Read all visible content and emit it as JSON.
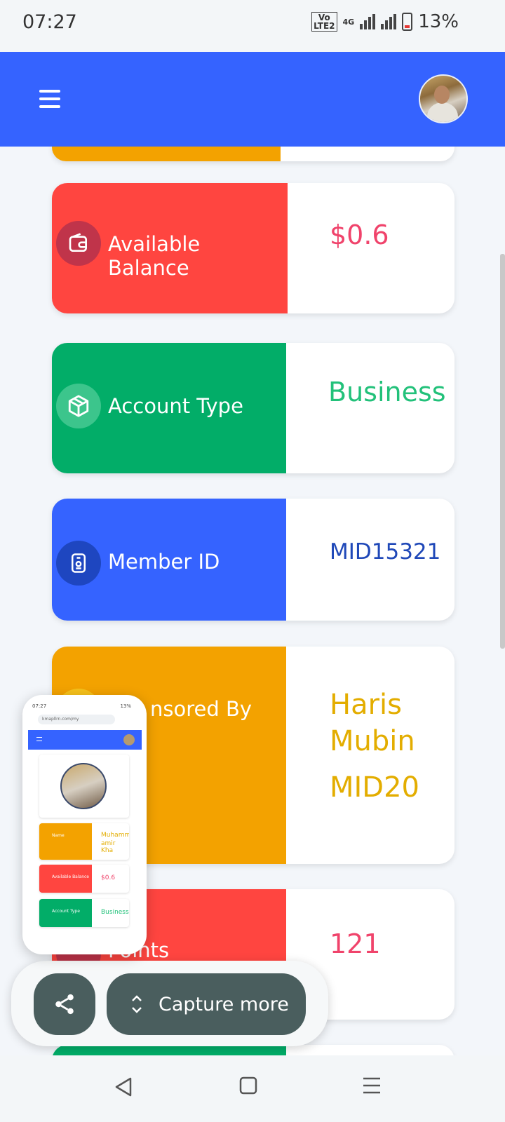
{
  "status_bar": {
    "time": "07:27",
    "network_top": "Vo",
    "network_bottom": "LTE2",
    "network_type": "4G",
    "battery_percent": "13%"
  },
  "header": {
    "menu_icon": "hamburger-menu-icon",
    "avatar_icon": "user-avatar-photo"
  },
  "cards": {
    "balance": {
      "label": "Available Balance",
      "value": "$0.6",
      "icon": "wallet-icon",
      "color": "#ff4540",
      "value_color": "#f0436b"
    },
    "account": {
      "label": "Account Type",
      "value": "Business",
      "icon": "cube-icon",
      "color": "#02ad68",
      "value_color": "#22c17a"
    },
    "member": {
      "label": "Member ID",
      "value": "MID15321",
      "icon": "id-badge-icon",
      "color": "#3563ff",
      "value_color": "#1f48b8"
    },
    "sponsor": {
      "label": "nsored By",
      "value_name_line1": "Haris",
      "value_name_line2": "Mubin",
      "value_id": "MID20",
      "color": "#f3a200",
      "value_color": "#e3ad00"
    },
    "points": {
      "label": "Points",
      "value": "121",
      "color": "#ff4540",
      "value_color": "#f0436b"
    }
  },
  "thumbnail": {
    "time": "07:27",
    "battery": "13%",
    "url": "kmapllrn.com/my",
    "name_label": "Name",
    "name_value_1": "Muhamm",
    "name_value_2": "amir Kha",
    "balance_label": "Available Balance",
    "balance_value": "$0.6",
    "account_label": "Account Type",
    "account_value": "Business"
  },
  "actions": {
    "share_icon": "share-icon",
    "capture_label": "Capture more"
  },
  "nav": {
    "back_icon": "back-triangle-icon",
    "home_icon": "home-square-icon",
    "recents_icon": "menu-lines-icon"
  }
}
